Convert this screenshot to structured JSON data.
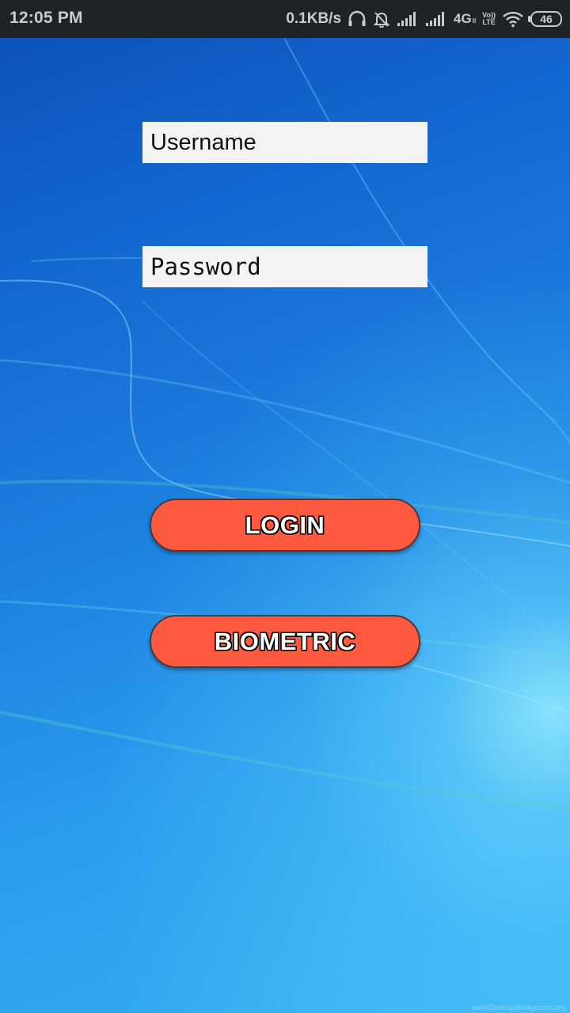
{
  "status_bar": {
    "time": "12:05 PM",
    "net_speed": "0.1KB/s",
    "network_type": "4G",
    "network_sub": "ll",
    "volte_top": "Vo))",
    "volte_bottom": "LTE",
    "battery_level": "46",
    "icons": [
      "headphones-icon",
      "notifications-off-icon",
      "signal-sim1-icon",
      "signal-sim2-icon",
      "volte-icon",
      "wifi-icon",
      "battery-icon"
    ]
  },
  "login_form": {
    "username_placeholder": "Username",
    "password_placeholder": "Password",
    "login_label": "LOGIN",
    "biometric_label": "BIOMETRIC"
  },
  "wallpaper": {
    "watermark": "www.DesktopBackground.org"
  },
  "colors": {
    "status_bar_bg": "#1f2326",
    "button_fill": "#ff5a3f",
    "field_bg": "#f3f3f3",
    "wallpaper_dark": "#0c4fb6",
    "wallpaper_light": "#38b0f4"
  }
}
